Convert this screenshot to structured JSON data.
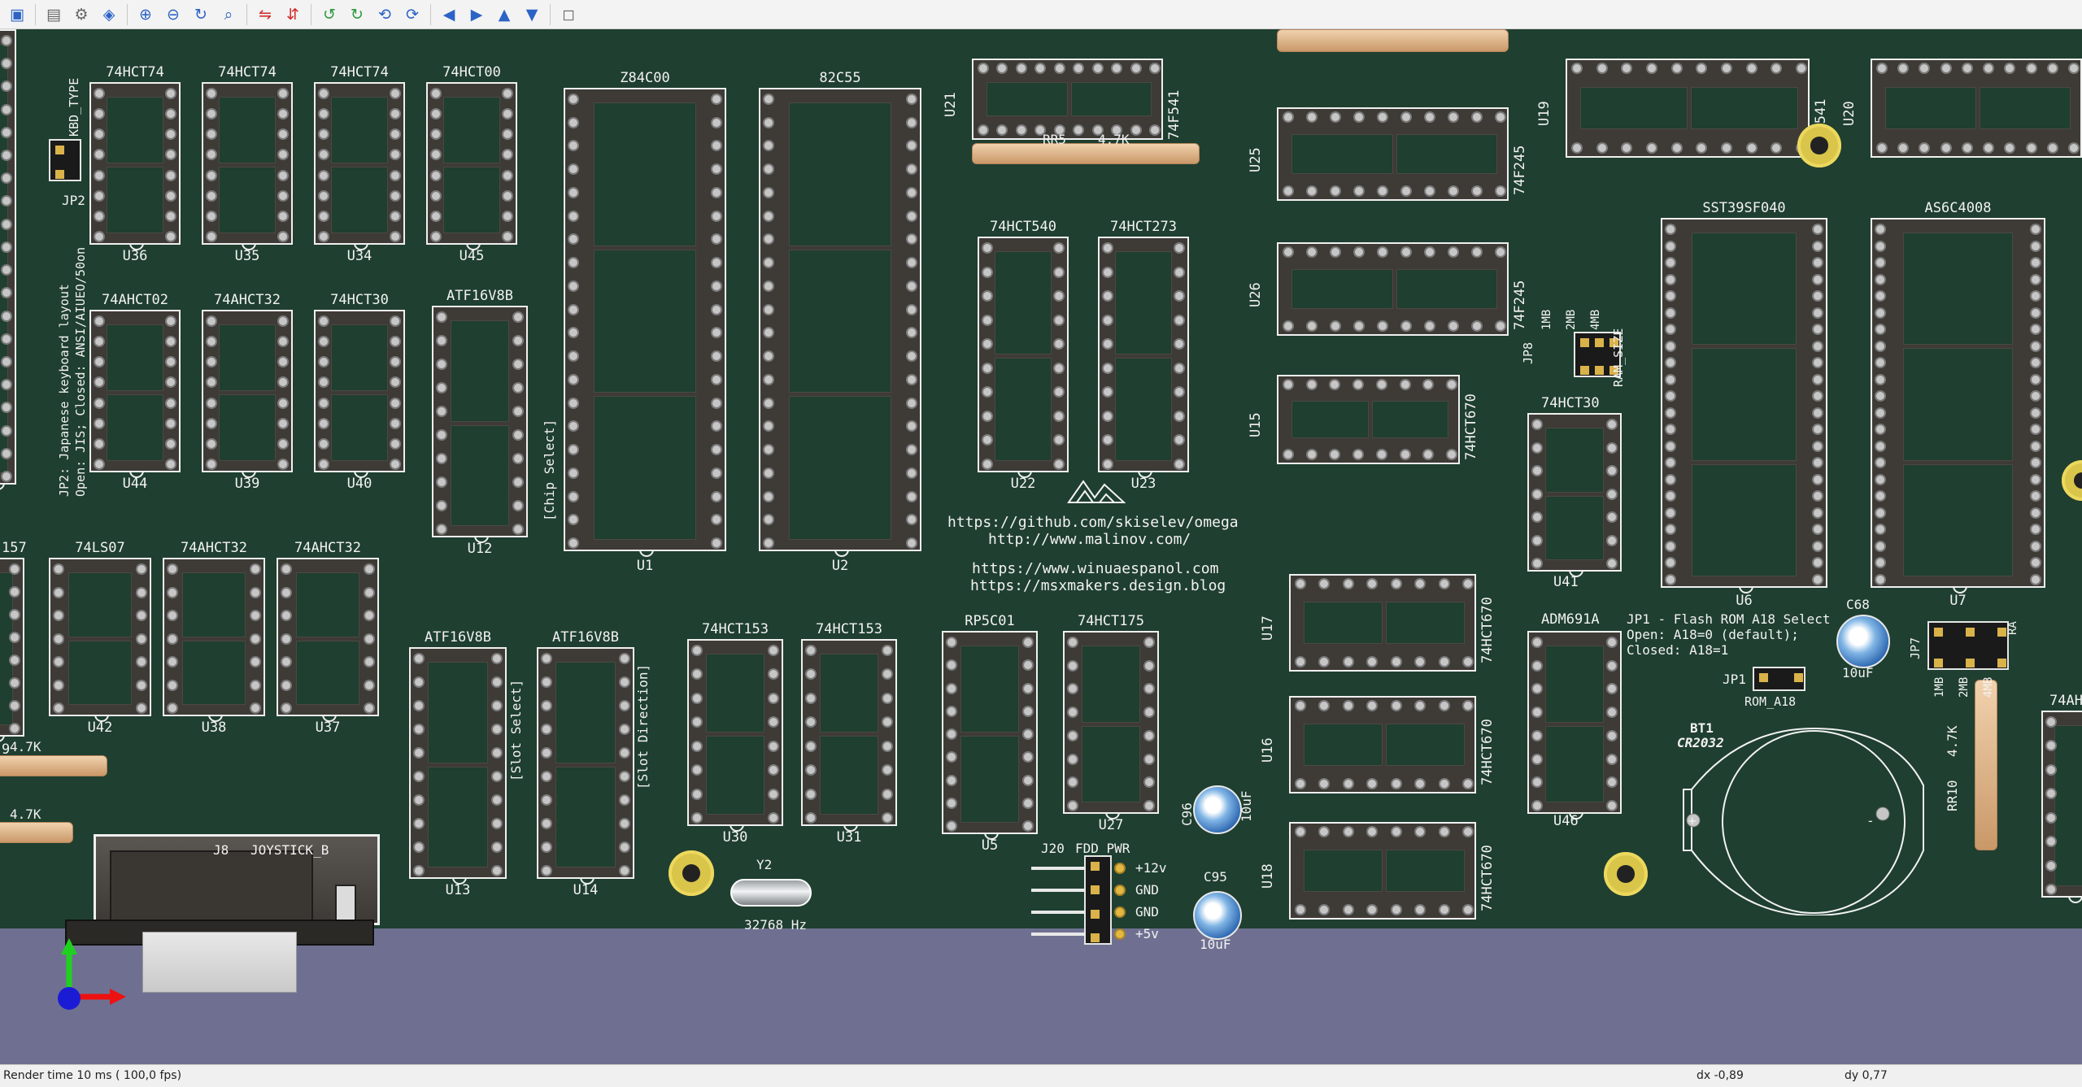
{
  "toolbar": {
    "icons": [
      "pcb-editor-icon",
      "board-setup-icon",
      "3d-options-icon",
      "layers-icon",
      "zoom-in-icon",
      "zoom-out-icon",
      "redraw-icon",
      "zoom-fit-icon",
      "flip-x-icon",
      "flip-y-icon",
      "rotate-x-icon",
      "rotate-y-icon",
      "rotate-z-icon",
      "rotate-z2-icon",
      "move-left-icon",
      "move-right-icon",
      "move-up-icon",
      "move-down-icon",
      "ortho-icon"
    ],
    "glyphs": [
      "▣",
      "▤",
      "⚙",
      "◈",
      "⊕",
      "⊖",
      "↻",
      "⌕",
      "⇋",
      "⇵",
      "↺",
      "↻",
      "⟲",
      "⟳",
      "◀",
      "▶",
      "▲",
      "▼",
      "◻"
    ]
  },
  "status": {
    "render_time": "Render time 10 ms ( 100,0 fps)",
    "dx": "dx -0,89",
    "dy": "dy 0,77"
  },
  "board": {
    "texts": {
      "kbd_type": "KBD_TYPE",
      "jp2": "JP2",
      "jp2_note_1": "JP2: Japanese keyboard layout",
      "jp2_note_2": "Open: JIS; Closed: ANSI/AIUEO/50on",
      "chip_select": "[Chip Select]",
      "slot_select": "[Slot Select]",
      "slot_direction": "[Slot Direction]",
      "url1": "https://github.com/skiselev/omega",
      "url2": "http://www.malinov.com/",
      "url3": "https://www.winuaespanol.com",
      "url4": "https://msxmakers.design.blog",
      "jp1_note_1": "JP1 - Flash ROM A18 Select",
      "jp1_note_2": "Open:  A18=0 (default);",
      "jp1_note_3": "Closed: A18=1",
      "jp1": "JP1",
      "rom_a18": "ROM_A18",
      "jp8": "JP8",
      "ram_size": "RAM_SIZE",
      "size_1mb": "1MB",
      "size_2mb": "2MB",
      "size_4mb": "4MB",
      "jp7": "JP7",
      "ram_size_cut": "RA",
      "jp7_1mb": "1MB",
      "jp7_2mb": "2MB",
      "jp7_4mb": "4MB",
      "bt1": "BT1",
      "cr2032": "CR2032",
      "plus": "+",
      "minus": "-",
      "j20": "J20",
      "fdd_pwr": "FDD_PWR",
      "p12": "+12v",
      "gnd1": "GND",
      "gnd2": "GND",
      "p5": "+5v",
      "y2": "Y2",
      "hz": "32768 Hz",
      "c96": "C96",
      "c96v": "10uF",
      "c95": "C95",
      "c95v": "10uF",
      "c68": "C68",
      "c68v": "10uF",
      "rr5": "RR5",
      "rr5v": "4.7K",
      "rr10": "RR10",
      "rr10v": "4.7K",
      "r47a": "4.7K",
      "r47b": "4.7K",
      "j8": "J8",
      "joystick": "JOYSTICK_B",
      "edge157": "157",
      "edge9": "9",
      "edge74ah": "74AH",
      "u41": "U41",
      "u41v": "74HCT30",
      "adm": "ADM691A",
      "u46": "U46"
    },
    "chips": [
      {
        "ref": "U36",
        "val": "74HCT74"
      },
      {
        "ref": "U35",
        "val": "74HCT74"
      },
      {
        "ref": "U34",
        "val": "74HCT74"
      },
      {
        "ref": "U45",
        "val": "74HCT00"
      },
      {
        "ref": "U44",
        "val": "74AHCT02"
      },
      {
        "ref": "U39",
        "val": "74AHCT32"
      },
      {
        "ref": "U40",
        "val": "74HCT30"
      },
      {
        "ref": "U12",
        "val": "ATF16V8B"
      },
      {
        "ref": "U1",
        "val": "Z84C00"
      },
      {
        "ref": "U2",
        "val": "82C55"
      },
      {
        "ref": "U22",
        "val": "74HCT540"
      },
      {
        "ref": "U23",
        "val": "74HCT273"
      },
      {
        "ref": "U42",
        "val": "74LS07"
      },
      {
        "ref": "U38",
        "val": "74AHCT32"
      },
      {
        "ref": "U37",
        "val": "74AHCT32"
      },
      {
        "ref": "U13",
        "val": "ATF16V8B"
      },
      {
        "ref": "U14",
        "val": "ATF16V8B"
      },
      {
        "ref": "U30",
        "val": "74HCT153"
      },
      {
        "ref": "U31",
        "val": "74HCT153"
      },
      {
        "ref": "U5",
        "val": "RP5C01"
      },
      {
        "ref": "U27",
        "val": "74HCT175"
      },
      {
        "ref": "U6",
        "val": "SST39SF040"
      },
      {
        "ref": "U7",
        "val": "AS6C4008"
      }
    ],
    "hchips": [
      {
        "ref": "U21",
        "val": "74F541"
      },
      {
        "ref": "U25",
        "val": "74F245"
      },
      {
        "ref": "U26",
        "val": "74F245"
      },
      {
        "ref": "U15",
        "val": "74HCT670"
      },
      {
        "ref": "U17",
        "val": "74HCT670"
      },
      {
        "ref": "U16",
        "val": "74HCT670"
      },
      {
        "ref": "U18",
        "val": "74HCT670"
      },
      {
        "ref": "U19",
        "val": "74F541"
      },
      {
        "ref": "U20",
        "val": ""
      }
    ]
  }
}
